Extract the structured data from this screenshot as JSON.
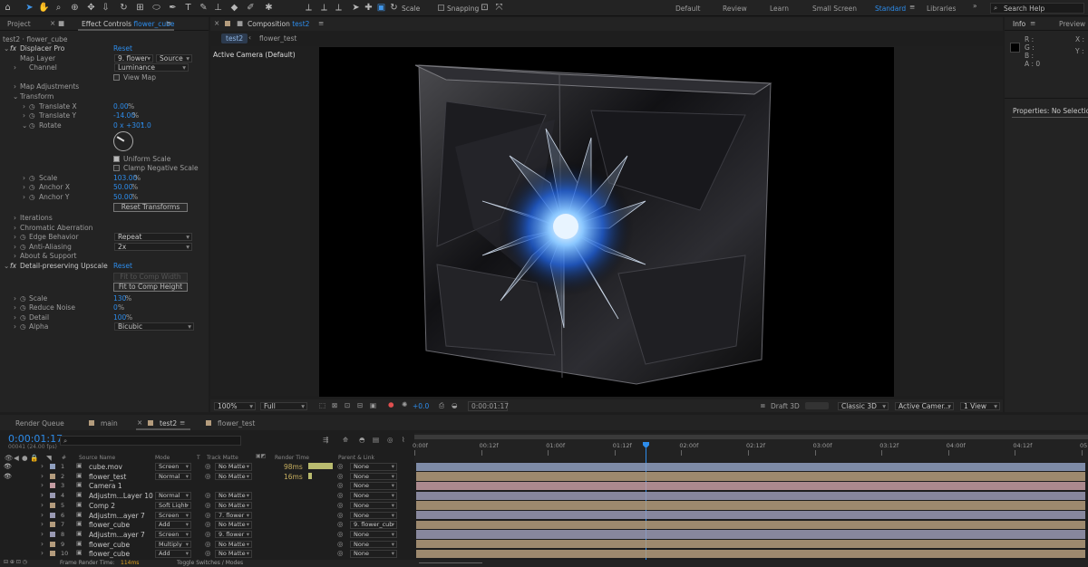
{
  "toolbar": {
    "snapping": "Snapping",
    "workspaces": [
      "Default",
      "Review",
      "Learn",
      "Small Screen",
      "Standard",
      "Libraries"
    ],
    "search_placeholder": "Search Help"
  },
  "left_panel": {
    "tab_project": "Project",
    "tab_effect_controls": "Effect Controls",
    "tab_effect_target": "flower_cube",
    "breadcrumb": "test2 · flower_cube",
    "rows": [
      {
        "label": "Displacer Pro",
        "value": "Reset"
      },
      {
        "label": "Map Layer",
        "dropdown": "9. flower_",
        "dropdown2": "Source"
      },
      {
        "label": "Channel",
        "dropdown": "Luminance"
      },
      {
        "label": "View Map"
      },
      {
        "label": "Map Adjustments"
      },
      {
        "label": "Transform"
      },
      {
        "label": "Translate X",
        "value": "0.00",
        "unit": "%"
      },
      {
        "label": "Translate Y",
        "value": "-14.00",
        "unit": "%"
      },
      {
        "label": "Rotate",
        "value": "0 x +301.0",
        "unit": "°"
      },
      {
        "label": "Uniform Scale"
      },
      {
        "label": "Clamp Negative Scale"
      },
      {
        "label": "Scale",
        "value": "103.00",
        "unit": "%"
      },
      {
        "label": "Anchor X",
        "value": "50.00",
        "unit": "%"
      },
      {
        "label": "Anchor Y",
        "value": "50.00",
        "unit": "%"
      },
      {
        "label": "Reset Transforms"
      },
      {
        "label": "Iterations"
      },
      {
        "label": "Chromatic Aberration"
      },
      {
        "label": "Edge Behavior",
        "dropdown": "Repeat"
      },
      {
        "label": "Anti-Aliasing",
        "dropdown": "2x"
      },
      {
        "label": "About & Support"
      },
      {
        "label": "Detail-preserving Upscale",
        "value": "Reset"
      },
      {
        "label": "Fit to Comp Width"
      },
      {
        "label": "Fit to Comp Height"
      },
      {
        "label": "Scale",
        "value": "130",
        "unit": "%"
      },
      {
        "label": "Reduce Noise",
        "value": "0",
        "unit": "%"
      },
      {
        "label": "Detail",
        "value": "100",
        "unit": "%"
      },
      {
        "label": "Alpha",
        "dropdown": "Bicubic"
      }
    ]
  },
  "composition": {
    "tab_label": "Composition",
    "comp_name": "test2",
    "nav": [
      "test2",
      "flower_test"
    ],
    "camera_label": "Active Camera (Default)",
    "zoom": "100%",
    "resolution": "Full",
    "exposure": "+0.0",
    "timecode": "0:00:01:17",
    "renderer": "Draft 3D",
    "renderer_mode": "Classic 3D",
    "camera": "Active Camer...",
    "views": "1 View"
  },
  "right_panel": {
    "tab_info": "Info",
    "tab_preview": "Preview",
    "r": "R :",
    "g": "G :",
    "b": "B :",
    "a": "A : 0",
    "x": "X :",
    "y": "Y :",
    "properties": "Properties: No Selection"
  },
  "timeline": {
    "tabs": [
      "Render Queue",
      "main",
      "test2",
      "flower_test"
    ],
    "timecode": "0:00:01:17",
    "frame_info": "00041 (24.00 fps)",
    "col_headers": {
      "source": "Source Name",
      "mode": "Mode",
      "t": "T",
      "matte": "Track Matte",
      "render": "Render Time",
      "parent": "Parent & Link"
    },
    "ruler": [
      "0:00f",
      "00:12f",
      "01:00f",
      "01:12f",
      "02:00f",
      "02:12f",
      "03:00f",
      "03:12f",
      "04:00f",
      "04:12f",
      "05:0"
    ],
    "layers": [
      {
        "num": "1",
        "name": "cube.mov",
        "mode": "Screen",
        "matte": "No Matte",
        "render": "98ms",
        "parent": "None",
        "color": "#8f9fbf",
        "eye": true
      },
      {
        "num": "2",
        "name": "flower_test",
        "mode": "Normal",
        "matte": "No Matte",
        "render": "16ms",
        "parent": "None",
        "color": "#b49c7d",
        "eye": true
      },
      {
        "num": "3",
        "name": "Camera 1",
        "mode": "",
        "matte": "",
        "render": "",
        "parent": "None",
        "color": "#c49ca2",
        "eye": false
      },
      {
        "num": "4",
        "name": "Adjustm...Layer 10",
        "mode": "Normal",
        "matte": "No Matte",
        "render": "",
        "parent": "None",
        "color": "#9a9ab4",
        "eye": false
      },
      {
        "num": "5",
        "name": "Comp 2",
        "mode": "Soft Light",
        "matte": "No Matte",
        "render": "",
        "parent": "None",
        "color": "#b49c7d",
        "eye": false
      },
      {
        "num": "6",
        "name": "Adjustm...ayer 7",
        "mode": "Screen",
        "matte": "7. flower",
        "render": "",
        "parent": "None",
        "color": "#9a9ab4",
        "eye": false
      },
      {
        "num": "7",
        "name": "flower_cube",
        "mode": "Add",
        "matte": "No Matte",
        "render": "",
        "parent": "9. flower_cub",
        "color": "#b49c7d",
        "eye": false
      },
      {
        "num": "8",
        "name": "Adjustm...ayer 7",
        "mode": "Screen",
        "matte": "9. flower",
        "render": "",
        "parent": "None",
        "color": "#9a9ab4",
        "eye": false
      },
      {
        "num": "9",
        "name": "flower_cube",
        "mode": "Multiply",
        "matte": "No Matte",
        "render": "",
        "parent": "None",
        "color": "#b49c7d",
        "eye": false
      },
      {
        "num": "10",
        "name": "flower_cube",
        "mode": "Add",
        "matte": "No Matte",
        "render": "",
        "parent": "None",
        "color": "#b49c7d",
        "eye": false
      }
    ],
    "footer_render": "Frame Render Time:",
    "footer_render_value": "114ms",
    "footer_toggle": "Toggle Switches / Modes"
  }
}
